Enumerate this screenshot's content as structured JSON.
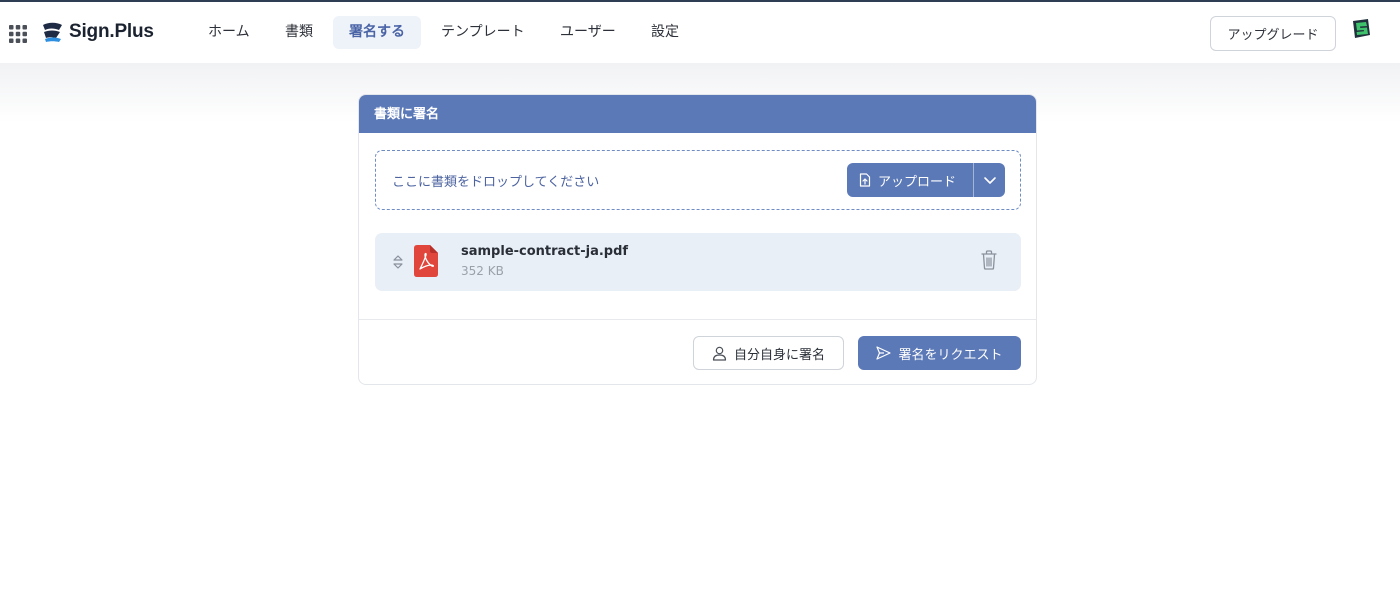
{
  "app": {
    "brand": "Sign.Plus"
  },
  "nav": {
    "items": [
      {
        "label": "ホーム"
      },
      {
        "label": "書類"
      },
      {
        "label": "署名する",
        "active": true
      },
      {
        "label": "テンプレート"
      },
      {
        "label": "ユーザー"
      },
      {
        "label": "設定"
      }
    ],
    "upgrade_label": "アップグレード"
  },
  "card": {
    "title": "書類に署名",
    "dropzone_text": "ここに書類をドロップしてください",
    "upload_label": "アップロード",
    "file": {
      "name": "sample-contract-ja.pdf",
      "size": "352 KB"
    },
    "self_sign_label": "自分自身に署名",
    "request_label": "署名をリクエスト"
  },
  "colors": {
    "accent": "#5b78b7",
    "nav_active_bg": "#eef2f9",
    "file_row_bg": "#e9eff6",
    "pdf_red": "#e0463c"
  },
  "icons": [
    "apps-grid-icon",
    "sign-plus-logo",
    "avatar-icon",
    "upload-file-icon",
    "chevron-down-icon",
    "drag-handle-icon",
    "pdf-file-icon",
    "trash-icon",
    "user-icon",
    "send-icon"
  ]
}
